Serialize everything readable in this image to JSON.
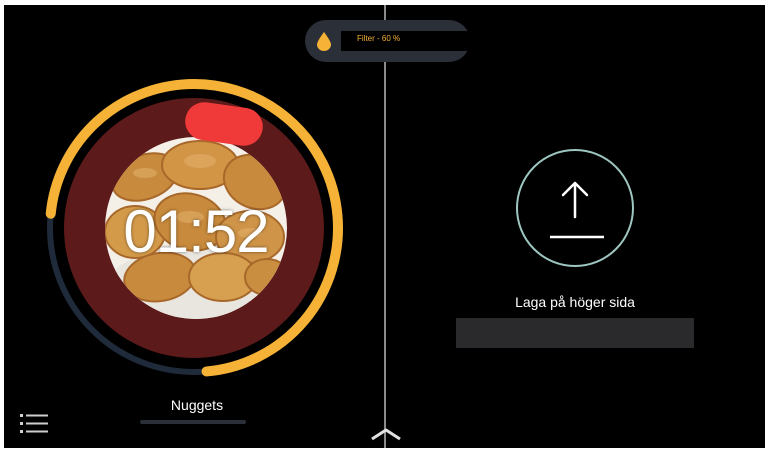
{
  "filter": {
    "label": "Filter - 60 %",
    "icon": "droplet-icon",
    "level_percent": 60
  },
  "timer": {
    "time": "01:52",
    "progress_fraction": 0.72,
    "food_image": "chicken-nuggets-photo",
    "program": "Nuggets"
  },
  "right": {
    "label": "Laga på höger sida",
    "icon": "upload-arrow-icon"
  },
  "nav": {
    "menu_icon": "list-menu-icon",
    "expand_icon": "chevron-up-icon"
  },
  "colors": {
    "timer_progress": "#f5b236",
    "timer_track": "#1f2a3a",
    "timer_fill": "#5c1a1a",
    "alert": "#f03a3a",
    "filter_drop": "#f5b236",
    "upload_ring": "#9ec6c0"
  }
}
